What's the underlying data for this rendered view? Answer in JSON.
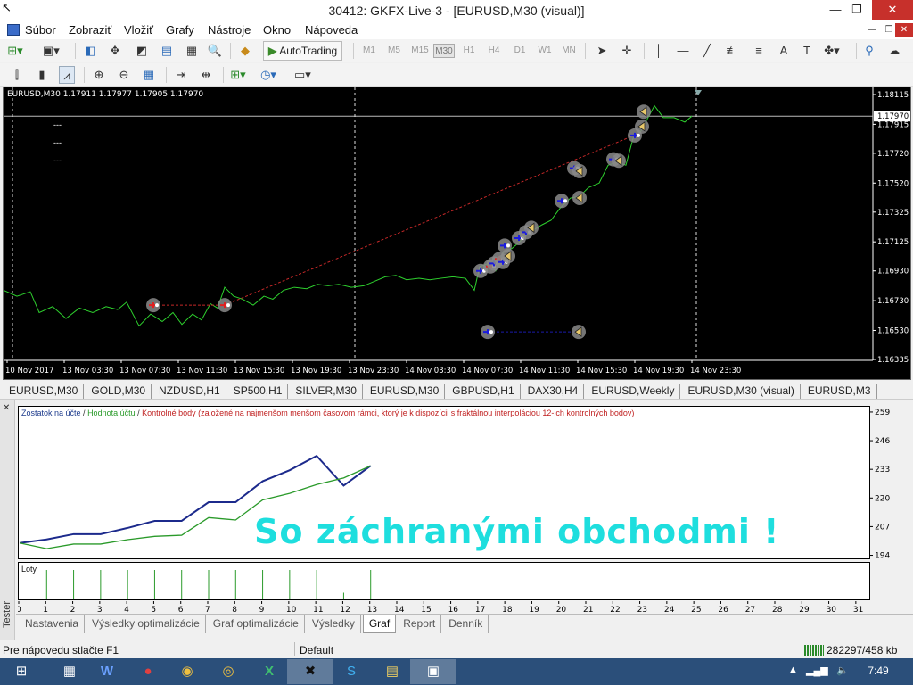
{
  "window": {
    "title": "30412: GKFX-Live-3 - [EURUSD,M30 (visual)]",
    "minimize": "—",
    "restore": "❐",
    "close": "✕"
  },
  "menu": {
    "items": [
      "Súbor",
      "Zobraziť",
      "Vložiť",
      "Grafy",
      "Nástroje",
      "Okno",
      "Nápoveda"
    ],
    "mdi_min": "—",
    "mdi_restore": "❐",
    "mdi_close": "✕"
  },
  "toolbar1": {
    "autotrading_label": "AutoTrading",
    "timeframes": [
      "M1",
      "M5",
      "M15",
      "M30",
      "H1",
      "H4",
      "D1",
      "W1",
      "MN"
    ],
    "selected_timeframe": "M30",
    "text_tool": "A"
  },
  "chart": {
    "symbol_line": "EURUSD,M30  1.17911 1.17977 1.17905 1.17970",
    "dash_lines": [
      "---",
      "---",
      "---"
    ],
    "current_price_label": "1.17970",
    "current_price": 1.1797,
    "price_ticks": [
      1.18115,
      1.17915,
      1.1772,
      1.1752,
      1.17325,
      1.17125,
      1.1693,
      1.1673,
      1.1653,
      1.16335
    ],
    "time_labels": [
      "10 Nov 2017",
      "13 Nov 03:30",
      "13 Nov 07:30",
      "13 Nov 11:30",
      "13 Nov 15:30",
      "13 Nov 19:30",
      "13 Nov 23:30",
      "14 Nov 03:30",
      "14 Nov 07:30",
      "14 Nov 11:30",
      "14 Nov 15:30",
      "14 Nov 19:30",
      "14 Nov 23:30"
    ],
    "colors": {
      "background": "#000000",
      "line": "#2ed12e",
      "trend": "#c62828",
      "trade_line": "#1a1aa8",
      "grid": "#ffffff"
    }
  },
  "symbol_tabs": [
    "EURUSD,M30",
    "GOLD,M30",
    "NZDUSD,H1",
    "SP500,H1",
    "SILVER,M30",
    "EURUSD,M30",
    "GBPUSD,H1",
    "DAX30,H4",
    "EURUSD,Weekly",
    "EURUSD,M30 (visual)",
    "EURUSD,M3"
  ],
  "tester": {
    "side_label": "Tester",
    "close_x": "✕",
    "overlay_text": "So záchranými obchodmi !",
    "legend": {
      "balance": "Zostatok na účte",
      "equity": "Hodnota účtu",
      "control": "Kontrolné body (založené na najmenšom menšom časovom rámci, ktorý je k dispozícii s fraktálnou interpoláciou 12-ich kontrolných bodov)",
      "separator": " / "
    },
    "lots_label": "Loty",
    "tabs": [
      "Nastavenia",
      "Výsledky optimalizácie",
      "Graf optimalizácie",
      "Výsledky",
      "Graf",
      "Report",
      "Denník"
    ],
    "active_tab": "Graf"
  },
  "chart_data": [
    {
      "type": "line",
      "title": "",
      "x": [
        0,
        1,
        2,
        3,
        4,
        5,
        6,
        7,
        8,
        9,
        10,
        11,
        12,
        13
      ],
      "series": [
        {
          "name": "Zostatok na účte",
          "values": [
            200,
            201.6,
            204,
            204,
            206.8,
            210,
            210,
            218.5,
            218.5,
            228,
            233,
            239.5,
            226,
            235
          ]
        },
        {
          "name": "Hodnota účtu",
          "values": [
            200,
            197.4,
            199.5,
            199.5,
            201.5,
            203,
            203.5,
            211.5,
            210.4,
            219.5,
            222.5,
            226.5,
            229.5,
            235
          ]
        }
      ],
      "y_ticks": [
        194,
        207,
        220,
        233,
        246,
        259
      ],
      "ylim": [
        193,
        261
      ],
      "x_ticks": [
        0,
        1,
        2,
        3,
        4,
        5,
        6,
        7,
        8,
        9,
        10,
        11,
        12,
        13,
        14,
        15,
        16,
        17,
        18,
        19,
        20,
        21,
        22,
        23,
        24,
        25,
        26,
        27,
        28,
        29,
        30,
        31
      ],
      "xlim": [
        0,
        31.5
      ],
      "colors": {
        "balance": "#1c2a8c",
        "equity": "#2a9a2a"
      }
    },
    {
      "type": "bar",
      "title": "Loty",
      "categories": [
        1,
        2,
        3,
        4,
        5,
        6,
        7,
        8,
        9,
        10,
        11,
        12,
        13
      ],
      "values": [
        1,
        1,
        1,
        1,
        1,
        1,
        1,
        1,
        1,
        1,
        1,
        0.25,
        1
      ],
      "xlim": [
        0,
        31.5
      ],
      "color": "#2a9a2a"
    }
  ],
  "status": {
    "help": "Pre nápovedu stlačte F1",
    "profile": "Default",
    "traffic": "282297/458 kb"
  },
  "taskbar": {
    "clock": "7:49",
    "apps": [
      "⊞",
      "▦",
      "W",
      "●",
      "◉",
      "◎",
      "X",
      "✖",
      "S",
      "▤",
      "▣"
    ]
  }
}
